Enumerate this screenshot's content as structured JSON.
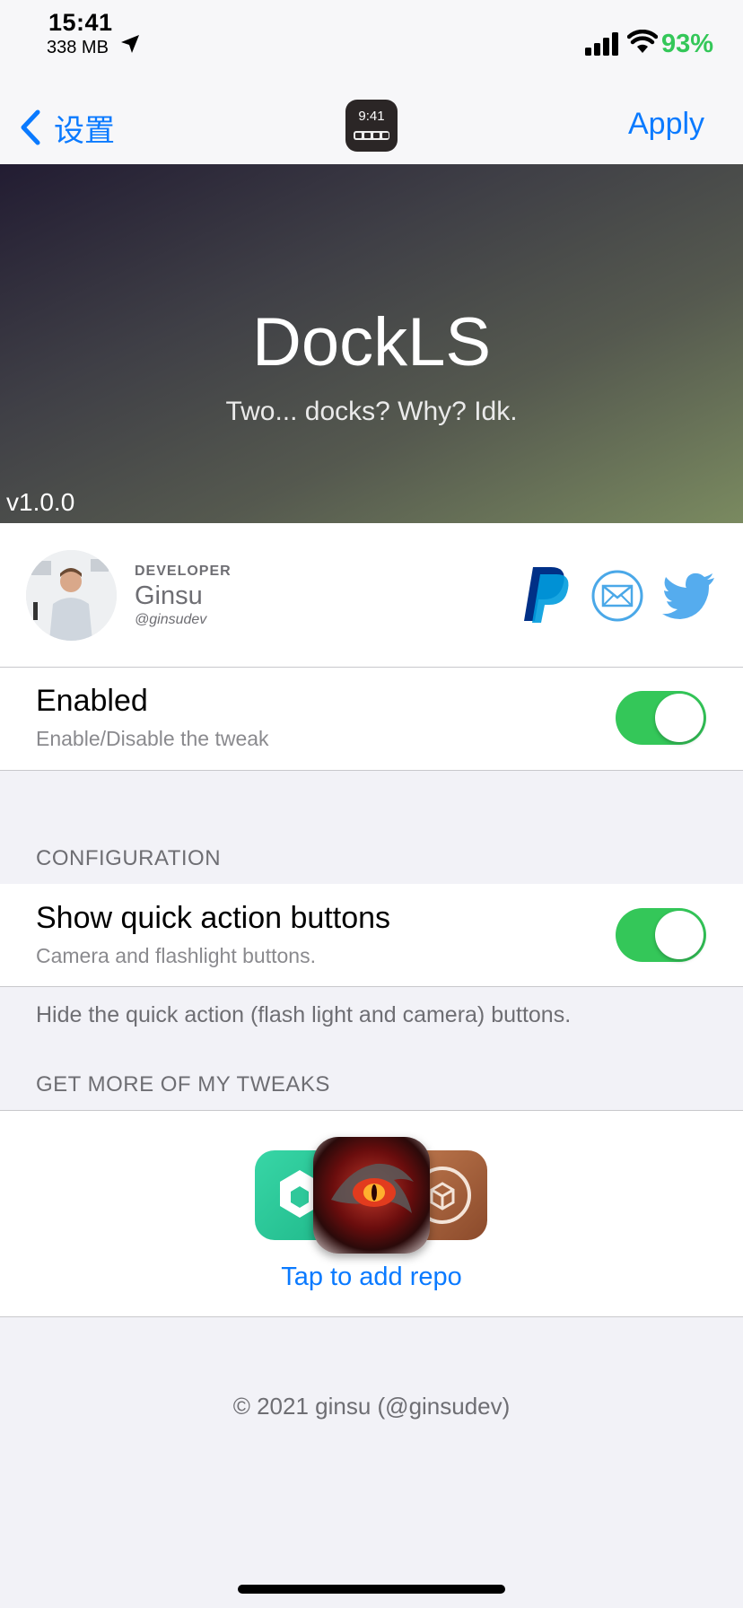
{
  "status_bar": {
    "time": "15:41",
    "memory": "338 MB",
    "battery": "93%"
  },
  "nav": {
    "back_label": "设置",
    "app_icon_time": "9:41",
    "apply_label": "Apply"
  },
  "header": {
    "title": "DockLS",
    "subtitle": "Two... docks? Why? Idk.",
    "version": "v1.0.0"
  },
  "developer": {
    "caption": "DEVELOPER",
    "name": "Ginsu",
    "handle": "@ginsudev"
  },
  "settings": {
    "enabled": {
      "title": "Enabled",
      "subtitle": "Enable/Disable the tweak",
      "on": true
    },
    "configuration_header": "CONFIGURATION",
    "quick_actions": {
      "title": "Show quick action buttons",
      "subtitle": "Camera and flashlight buttons.",
      "on": true
    },
    "quick_actions_footer": "Hide the quick action (flash light and camera) buttons."
  },
  "tweaks": {
    "header": "GET MORE OF MY TWEAKS",
    "link_label": "Tap to add repo"
  },
  "footer": {
    "copyright": "© 2021 ginsu (@ginsudev)"
  },
  "colors": {
    "accent": "#0a7aff",
    "toggle_on": "#34c759",
    "battery": "#34c759"
  }
}
